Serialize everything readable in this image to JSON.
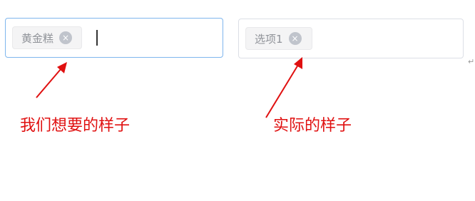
{
  "left_select": {
    "tag_label": "黄金糕",
    "close_icon": "×"
  },
  "right_select": {
    "tag_label": "选项1",
    "close_icon": "×"
  },
  "captions": {
    "wanted": "我们想要的样子",
    "actual": "实际的样子"
  },
  "paragraph_mark": "↵",
  "colors": {
    "annotation_red": "#e01010",
    "focus_border": "#7fb6ee",
    "default_border": "#dcdfe6",
    "tag_text": "#909399"
  }
}
